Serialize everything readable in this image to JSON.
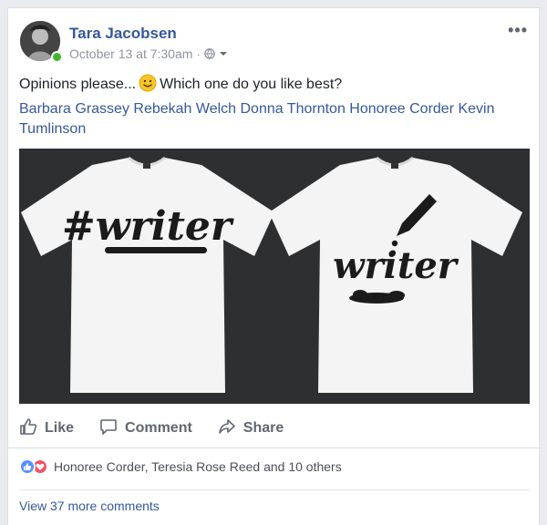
{
  "post": {
    "author": "Tara Jacobsen",
    "timestamp": "October 13 at 7:30am",
    "separator": "·",
    "audience_icon": "globe-icon",
    "more_label": "•••",
    "text_before_emoji": "Opinions please...",
    "emoji": "slightly-smiling-face",
    "text_after_emoji": "Which one do you like best?",
    "tags": [
      "Barbara Grassey",
      "Rebekah Welch",
      "Donna Thornton",
      "Honoree Corder",
      "Kevin Tumlinson"
    ],
    "image": {
      "shirts": [
        {
          "design": "#writer"
        },
        {
          "design": "writer"
        }
      ]
    }
  },
  "actions": {
    "like": "Like",
    "comment": "Comment",
    "share": "Share"
  },
  "reactions": {
    "types": [
      "like",
      "love"
    ],
    "summary": "Honoree Corder, Teresia Rose Reed and 10 others"
  },
  "comments": {
    "view_more": "View 37 more comments"
  },
  "colors": {
    "link_blue": "#365899",
    "online_green": "#42b72a",
    "like_blue": "#5890ff",
    "love_red": "#f25268",
    "photo_bg": "#2e2f31"
  }
}
